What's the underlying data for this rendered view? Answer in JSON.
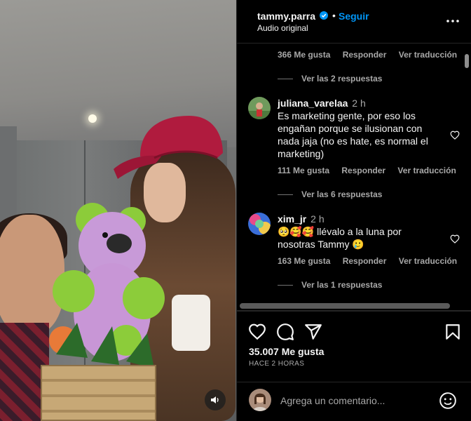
{
  "post": {
    "username": "tammy.parra",
    "dot": "•",
    "follow_label": "Seguir",
    "audio_label": "Audio original",
    "likes": "35.007 Me gusta",
    "time_ago": "HACE 2 HORAS"
  },
  "comments": {
    "top_meta": {
      "likes": "366 Me gusta",
      "reply": "Responder",
      "translate": "Ver traducción",
      "view_replies": "Ver las 2 respuestas"
    },
    "items": [
      {
        "user": "juliana_varelaa",
        "time": "2 h",
        "text": "Es marketing gente, por eso los engañan porque se ilusionan con nada jaja (no es hate, es normal el marketing)",
        "likes": "111 Me gusta",
        "reply": "Responder",
        "translate": "Ver traducción",
        "view_replies": "Ver las 6 respuestas"
      },
      {
        "user": "xim_jr",
        "time": "2 h",
        "text": "🥺🥰🥰 llévalo a la luna por nosotras Tammy 🥲",
        "likes": "163 Me gusta",
        "reply": "Responder",
        "translate": "Ver traducción",
        "view_replies": "Ver las 1 respuestas"
      }
    ]
  },
  "compose": {
    "placeholder": "Agrega un comentario..."
  },
  "colors": {
    "accent": "#0095f6",
    "background": "#000000",
    "muted": "#a8a8a8"
  },
  "icons": [
    "verified-icon",
    "more-options-icon",
    "heart-icon",
    "comment-icon",
    "share-icon",
    "bookmark-icon",
    "emoji-icon",
    "sound-icon"
  ]
}
